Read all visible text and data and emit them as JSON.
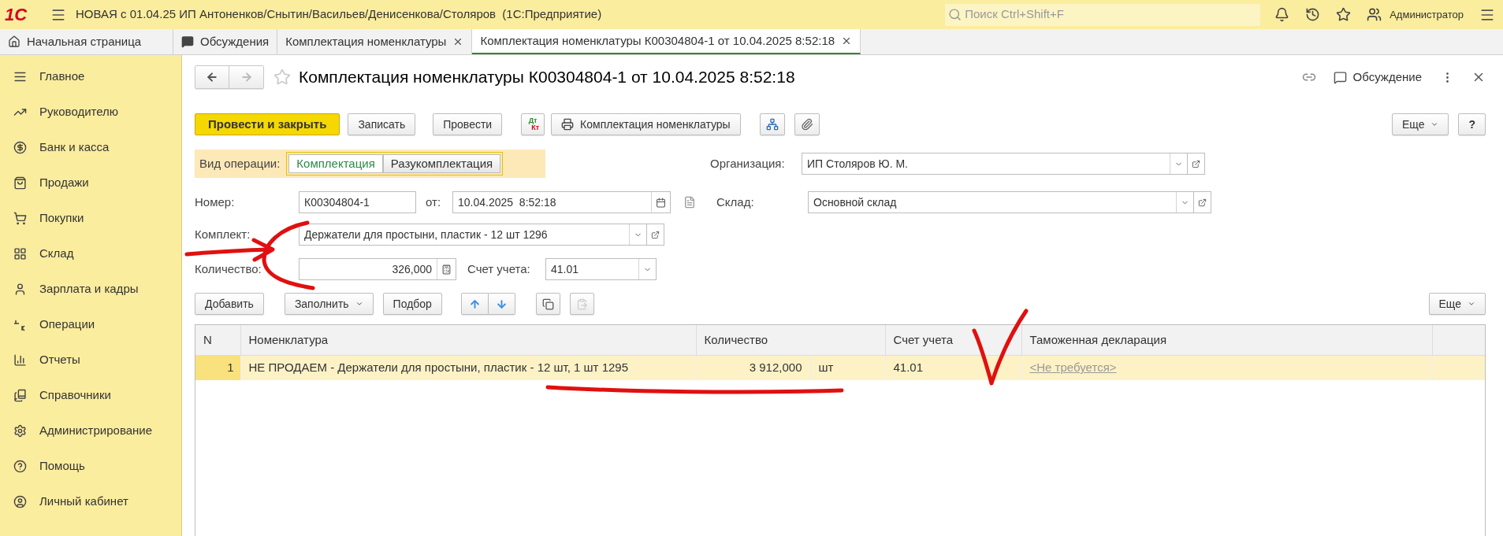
{
  "window": {
    "logo": "1С",
    "title": "НОВАЯ с 01.04.25 ИП Антоненков/Снытин/Васильев/Денисенкова/Столяров  (1С:Предприятие)",
    "search_placeholder": "Поиск Ctrl+Shift+F",
    "user": "Администратор"
  },
  "tabs": [
    {
      "kind": "home",
      "label": "Начальная страница",
      "closable": false,
      "selected": false
    },
    {
      "kind": "chat",
      "label": "Обсуждения",
      "closable": false,
      "selected": false
    },
    {
      "kind": "doc",
      "label": "Комплектация номенклатуры",
      "closable": true,
      "selected": false
    },
    {
      "kind": "doc",
      "label": "Комплектация номенклатуры К00304804-1 от 10.04.2025 8:52:18",
      "closable": true,
      "selected": true
    }
  ],
  "sidebar": {
    "items": [
      "Главное",
      "Руководителю",
      "Банк и касса",
      "Продажи",
      "Покупки",
      "Склад",
      "Зарплата и кадры",
      "Операции",
      "Отчеты",
      "Справочники",
      "Администрирование",
      "Помощь",
      "Личный кабинет"
    ]
  },
  "form": {
    "title": "Комплектация номенклатуры К00304804-1 от 10.04.2025 8:52:18",
    "favorite": false,
    "discussion": "Обсуждение",
    "toolbar": {
      "post_close": "Провести и закрыть",
      "save": "Записать",
      "post": "Провести",
      "dt": "Дт",
      "kt": "Кт",
      "print": "Комплектация номенклатуры",
      "more": "Еще",
      "help": "?"
    },
    "operation": {
      "label": "Вид операции:",
      "options": [
        {
          "label": "Комплектация",
          "selected": true
        },
        {
          "label": "Разукомплектация",
          "selected": false
        }
      ]
    },
    "organization": {
      "label": "Организация:",
      "value": "ИП Столяров Ю. М."
    },
    "number": {
      "label": "Номер:",
      "value": "К00304804-1"
    },
    "date": {
      "label": "от:",
      "value": "10.04.2025  8:52:18"
    },
    "warehouse": {
      "label": "Склад:",
      "value": "Основной склад"
    },
    "kit": {
      "label": "Комплект:",
      "value": "Держатели для простыни, пластик - 12 шт 1296"
    },
    "quantity": {
      "label": "Количество:",
      "value": "326,000"
    },
    "account": {
      "label": "Счет учета:",
      "value": "41.01"
    }
  },
  "table_toolbar": {
    "add": "Добавить",
    "fill": "Заполнить",
    "pick": "Подбор",
    "paste_disabled": true,
    "more": "Еще"
  },
  "table": {
    "columns": [
      "N",
      "Номенклатура",
      "Количество",
      "Счет учета",
      "Таможенная декларация"
    ],
    "rows": [
      {
        "n": "1",
        "item": "НЕ ПРОДАЕМ - Держатели для простыни, пластик - 12 шт, 1 шт 1295",
        "quantity": "3 912,000",
        "unit": "шт",
        "account": "41.01",
        "declaration": "<Не требуется>",
        "selected": true
      }
    ]
  }
}
